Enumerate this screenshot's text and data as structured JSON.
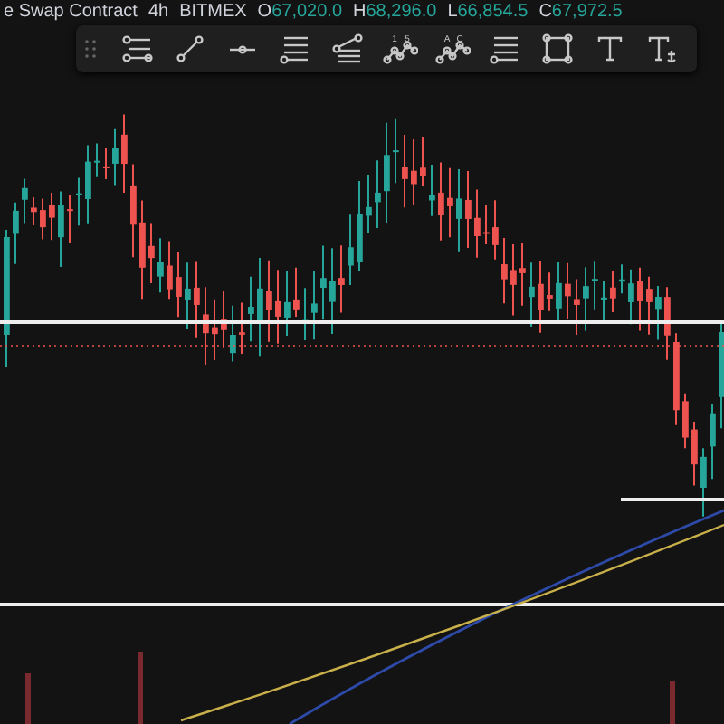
{
  "legend": {
    "symbol": "e Swap Contract",
    "interval": "4h",
    "exchange": "BITMEX",
    "values": [
      {
        "label": "O",
        "value": "67,020.0"
      },
      {
        "label": "H",
        "value": "68,296.0"
      },
      {
        "label": "L",
        "value": "66,854.5"
      },
      {
        "label": "C",
        "value": "67,972.5"
      }
    ]
  },
  "toolbar": {
    "tools": [
      {
        "kind": "parallel-channel"
      },
      {
        "kind": "trend-line"
      },
      {
        "kind": "horizontal-ray"
      },
      {
        "kind": "lines-set"
      },
      {
        "kind": "fan"
      },
      {
        "kind": "pattern",
        "marks": [
          "1",
          "5"
        ]
      },
      {
        "kind": "pattern",
        "marks": [
          "A",
          "C"
        ]
      },
      {
        "kind": "lines-set"
      },
      {
        "kind": "rectangle"
      },
      {
        "kind": "text"
      },
      {
        "kind": "anchored-text"
      }
    ]
  }
}
